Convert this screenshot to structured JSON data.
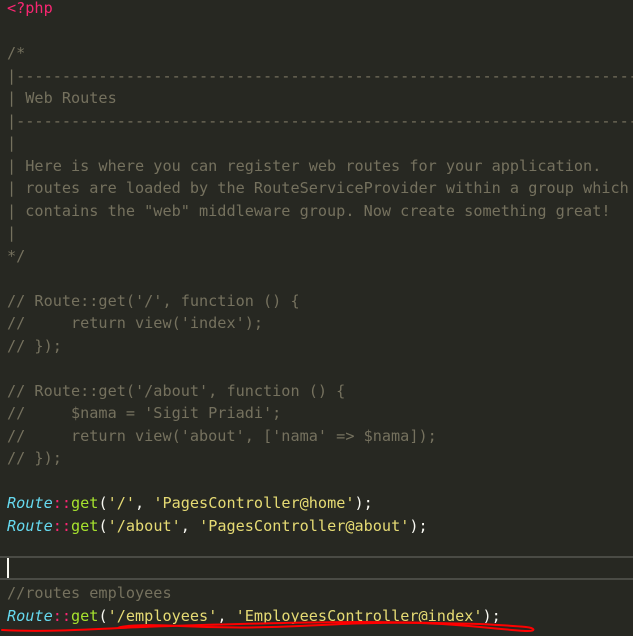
{
  "editor": {
    "theme_colors": {
      "background": "#272822",
      "comment": "#75715e",
      "tag": "#f92672",
      "class": "#66d9ef",
      "operator": "#f92672",
      "function": "#a6e22e",
      "string": "#e6db74",
      "punct": "#f8f8f2",
      "error_underline": "#ff0000"
    },
    "lines": [
      [
        {
          "t": "tag",
          "v": "<?php"
        }
      ],
      [],
      [
        {
          "t": "comment",
          "v": "/*"
        }
      ],
      [
        {
          "t": "comment",
          "v": "|--------------------------------------------------------------------------"
        }
      ],
      [
        {
          "t": "comment",
          "v": "| Web Routes"
        }
      ],
      [
        {
          "t": "comment",
          "v": "|--------------------------------------------------------------------------"
        }
      ],
      [
        {
          "t": "comment",
          "v": "|"
        }
      ],
      [
        {
          "t": "comment",
          "v": "| Here is where you can register web routes for your application."
        }
      ],
      [
        {
          "t": "comment",
          "v": "| routes are loaded by the RouteServiceProvider within a group which"
        }
      ],
      [
        {
          "t": "comment",
          "v": "| contains the \"web\" middleware group. Now create something great!"
        }
      ],
      [
        {
          "t": "comment",
          "v": "|"
        }
      ],
      [
        {
          "t": "comment",
          "v": "*/"
        }
      ],
      [],
      [
        {
          "t": "comment",
          "v": "// Route::get('/', function () {"
        }
      ],
      [
        {
          "t": "comment",
          "v": "//     return view('index');"
        }
      ],
      [
        {
          "t": "comment",
          "v": "// });"
        }
      ],
      [],
      [
        {
          "t": "comment",
          "v": "// Route::get('/about', function () {"
        }
      ],
      [
        {
          "t": "comment",
          "v": "//     $nama = 'Sigit Priadi';"
        }
      ],
      [
        {
          "t": "comment",
          "v": "//     return view('about', ['nama' => $nama]);"
        }
      ],
      [
        {
          "t": "comment",
          "v": "// });"
        }
      ],
      [],
      [
        {
          "t": "class",
          "v": "Route"
        },
        {
          "t": "operator",
          "v": "::"
        },
        {
          "t": "function",
          "v": "get"
        },
        {
          "t": "punct",
          "v": "("
        },
        {
          "t": "string",
          "v": "'/'"
        },
        {
          "t": "punct",
          "v": ", "
        },
        {
          "t": "string",
          "v": "'PagesController@home'"
        },
        {
          "t": "punct",
          "v": ");"
        }
      ],
      [
        {
          "t": "class",
          "v": "Route"
        },
        {
          "t": "operator",
          "v": "::"
        },
        {
          "t": "function",
          "v": "get"
        },
        {
          "t": "punct",
          "v": "("
        },
        {
          "t": "string",
          "v": "'/about'"
        },
        {
          "t": "punct",
          "v": ", "
        },
        {
          "t": "string",
          "v": "'PagesController@about'"
        },
        {
          "t": "punct",
          "v": ");"
        }
      ],
      [],
      [],
      [
        {
          "t": "comment",
          "v": "//routes employees"
        }
      ],
      [
        {
          "t": "class",
          "v": "Route"
        },
        {
          "t": "operator",
          "v": "::"
        },
        {
          "t": "function",
          "v": "get"
        },
        {
          "t": "punct",
          "v": "("
        },
        {
          "t": "string",
          "v": "'/employees'"
        },
        {
          "t": "punct",
          "v": ", "
        },
        {
          "t": "string",
          "v": "'EmployeesController@index'"
        },
        {
          "t": "punct",
          "v": ");"
        }
      ]
    ]
  }
}
